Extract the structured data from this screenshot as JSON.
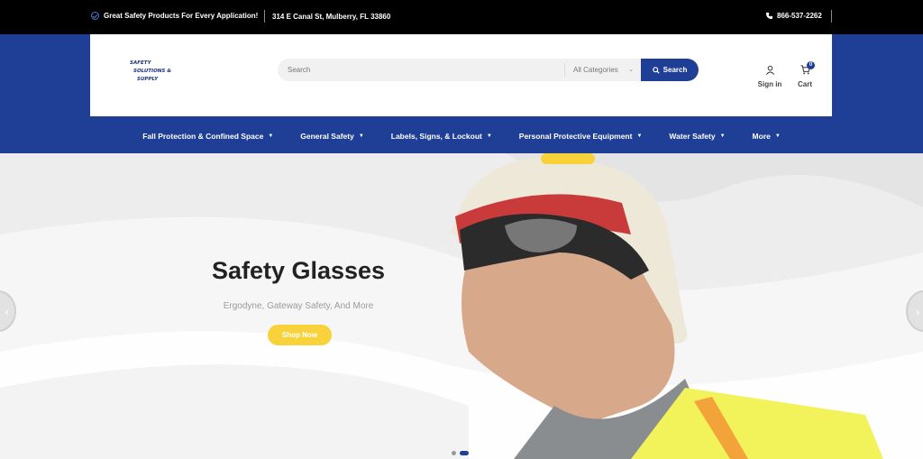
{
  "topbar": {
    "promo": "Great Safety Products For Every Application!",
    "address": "314 E Canal St, Mulberry, FL 33860",
    "phone": "866-537-2262"
  },
  "header": {
    "logo_lines": [
      "SAFETY",
      "SOLUTIONS &",
      "SUPPLY"
    ],
    "search": {
      "placeholder": "Search",
      "category": "All Categories",
      "button": "Search"
    },
    "signin_label": "Sign in",
    "cart_label": "Cart",
    "cart_count": "0"
  },
  "nav": {
    "items": [
      "Fall Protection & Confined Space",
      "General Safety",
      "Labels, Signs, & Lockout",
      "Personal Protective Equipment",
      "Water Safety",
      "More"
    ]
  },
  "hero": {
    "title": "Safety Glasses",
    "subtitle": "Ergodyne, Gateway Safety, And More",
    "cta": "Shop Now",
    "slide_count": 2,
    "active_slide": 2
  },
  "colors": {
    "brand_blue": "#1f3e96",
    "accent_yellow": "#f7d23b",
    "topbar": "#000000"
  }
}
